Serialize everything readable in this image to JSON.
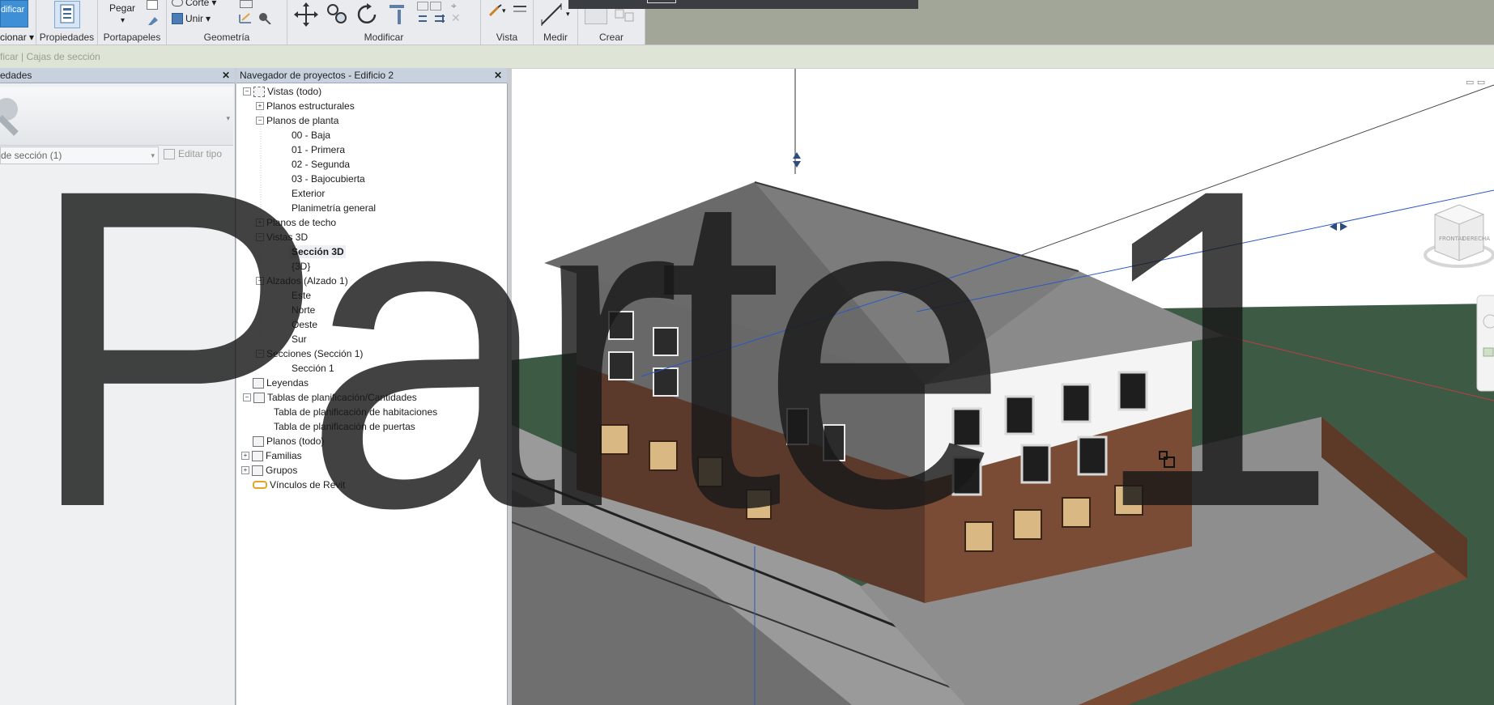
{
  "ribbon": {
    "modify_label": "dificar",
    "select_label": "cionar",
    "properties_button": "Propiedades",
    "paste_button": "Pegar",
    "cut_label": "Corte",
    "join_label": "Unir",
    "groups": {
      "clipboard": "Portapapeles",
      "geometry": "Geometría",
      "modify": "Modificar",
      "view": "Vista",
      "measure": "Medir",
      "create": "Crear"
    }
  },
  "options_bar": {
    "text": "ficar | Cajas de sección"
  },
  "properties_panel": {
    "title": "edades",
    "type_selector": "de sección (1)",
    "edit_type": "Editar tipo"
  },
  "project_browser": {
    "title": "Navegador de proyectos - Edificio 2",
    "items": [
      {
        "label": "Vistas (todo)"
      },
      {
        "label": "Planos estructurales"
      },
      {
        "label": "Planos de planta"
      },
      {
        "label": "00 - Baja"
      },
      {
        "label": "01 - Primera"
      },
      {
        "label": "02 - Segunda"
      },
      {
        "label": "03 - Bajocubierta"
      },
      {
        "label": "Exterior"
      },
      {
        "label": "Planimetría general"
      },
      {
        "label": "Planos de techo"
      },
      {
        "label": "Vistas 3D"
      },
      {
        "label": "Sección 3D"
      },
      {
        "label": "{3D}"
      },
      {
        "label": "Alzados (Alzado 1)"
      },
      {
        "label": "Este"
      },
      {
        "label": "Norte"
      },
      {
        "label": "Oeste"
      },
      {
        "label": "Sur"
      },
      {
        "label": "Secciones (Sección 1)"
      },
      {
        "label": "Sección 1"
      },
      {
        "label": "Leyendas"
      },
      {
        "label": "Tablas de planificación/Cantidades"
      },
      {
        "label": "Tabla de planificación de habitaciones"
      },
      {
        "label": "Tabla de planificación de puertas"
      },
      {
        "label": "Planos (todo)"
      },
      {
        "label": "Familias"
      },
      {
        "label": "Grupos"
      },
      {
        "label": "Vínculos de Revit"
      }
    ]
  },
  "viewcube": {
    "front": "FRONTAL",
    "right": "DERECHA"
  },
  "overlay_text": "Parte 1"
}
